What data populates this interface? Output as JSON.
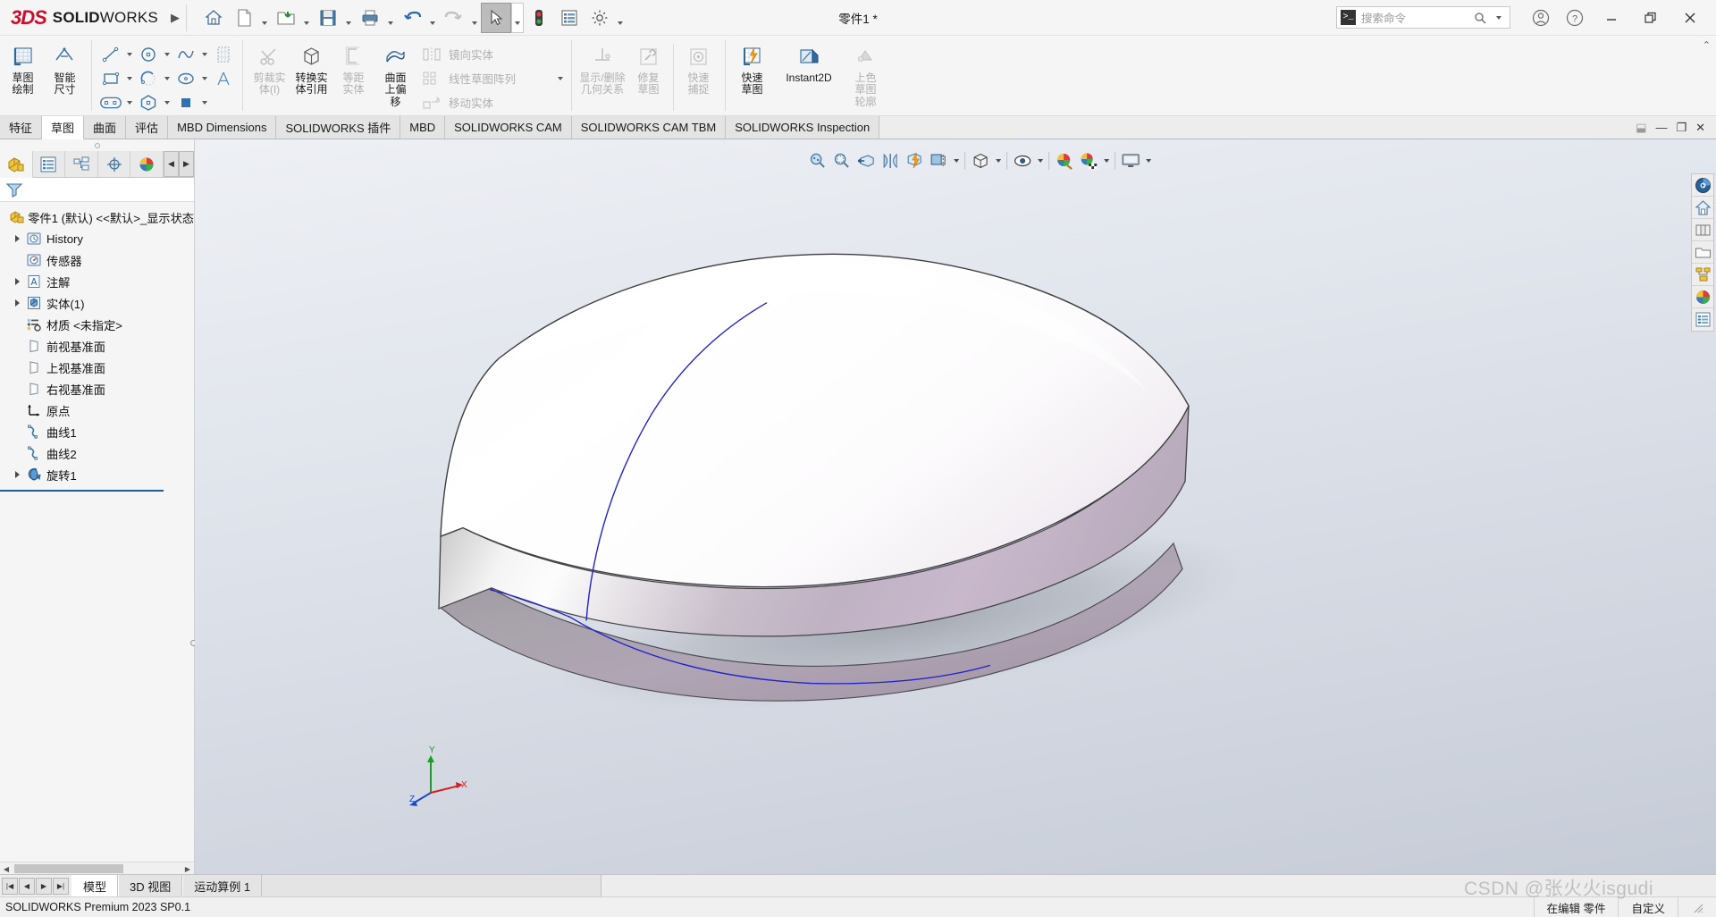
{
  "app": {
    "brand_ds": "3DS",
    "brand_solid": "SOLID",
    "brand_works": "WORKS",
    "document_title": "零件1 *",
    "version_status": "SOLIDWORKS Premium 2023 SP0.1"
  },
  "titlebar": {
    "icons": [
      {
        "name": "home-icon",
        "label": "主页"
      },
      {
        "name": "new-document-icon",
        "label": "新建"
      },
      {
        "name": "open-folder-icon",
        "label": "打开"
      },
      {
        "name": "save-icon",
        "label": "保存"
      },
      {
        "name": "print-icon",
        "label": "打印"
      },
      {
        "name": "undo-icon",
        "label": "撤销"
      },
      {
        "name": "redo-icon",
        "label": "重做"
      },
      {
        "name": "select-cursor-icon",
        "label": "选择"
      },
      {
        "name": "rebuild-traffic-icon",
        "label": "重建模型"
      },
      {
        "name": "options-list-icon",
        "label": "文件属性"
      },
      {
        "name": "gear-settings-icon",
        "label": "选项"
      }
    ],
    "search": {
      "placeholder": "搜索命令",
      "icon": "command-search-icon"
    },
    "account_icon": "account-circle-icon",
    "help_icon": "question-help-icon",
    "minimize_label": "最小化",
    "restore_label": "向下还原",
    "close_label": "关闭"
  },
  "ribbon": {
    "groups": [
      {
        "name": "sketch-group",
        "buttons": [
          {
            "name": "sketch-draw-button",
            "label": "草图\n绘制",
            "icon": "sketch-grid-icon",
            "disabled": false
          },
          {
            "name": "smart-dimension-button",
            "label": "智能\n尺寸",
            "icon": "smart-dimension-icon",
            "disabled": false
          }
        ]
      },
      {
        "name": "entities-group",
        "rows": [
          [
            {
              "name": "line-tool",
              "icon": "line-icon",
              "caret": true
            },
            {
              "name": "circle-tool",
              "icon": "circle-icon",
              "caret": true
            },
            {
              "name": "spline-tool",
              "icon": "spline-icon",
              "caret": true
            },
            {
              "name": "3dsketch-plane-tool",
              "icon": "sketch-plane-icon",
              "caret": false
            }
          ],
          [
            {
              "name": "rectangle-tool",
              "icon": "rectangle-icon",
              "caret": true
            },
            {
              "name": "arc-tool",
              "icon": "arc-icon",
              "caret": true
            },
            {
              "name": "ellipse-tool",
              "icon": "ellipse-icon",
              "caret": true
            },
            {
              "name": "text-tool",
              "icon": "text-a-icon",
              "caret": false
            }
          ],
          [
            {
              "name": "slot-tool",
              "icon": "slot-icon",
              "caret": true
            },
            {
              "name": "polygon-tool",
              "icon": "polygon-icon",
              "caret": false
            },
            {
              "name": "point-tool",
              "icon": "point-square-icon",
              "caret": true
            }
          ]
        ]
      },
      {
        "name": "modify-group",
        "buttons": [
          {
            "name": "trim-entities-button",
            "label": "剪裁实\n体(I)",
            "icon": "trim-scissors-icon",
            "disabled": true
          },
          {
            "name": "convert-entities-button",
            "label": "转换实\n体引用",
            "icon": "convert-cube-icon",
            "disabled": false
          },
          {
            "name": "offset-entities-button",
            "label": "等距\n实体",
            "icon": "offset-icon",
            "disabled": true
          },
          {
            "name": "offset-on-surface-button",
            "label": "曲面\n上偏\n移",
            "icon": "surface-offset-icon",
            "disabled": false
          }
        ],
        "side_items": [
          {
            "name": "mirror-entities-item",
            "label": "镜向实体",
            "icon": "mirror-icon",
            "disabled": true
          },
          {
            "name": "linear-sketch-pattern-item",
            "label": "线性草图阵列",
            "icon": "linear-pattern-icon",
            "disabled": true,
            "caret": true
          },
          {
            "name": "move-entities-item",
            "label": "移动实体",
            "icon": "move-entities-icon",
            "disabled": true,
            "caret": true
          }
        ]
      },
      {
        "name": "relations-group",
        "buttons": [
          {
            "name": "display-delete-relations-button",
            "label": "显示/删除\n几何关系",
            "icon": "relations-icon",
            "disabled": true
          },
          {
            "name": "repair-sketch-button",
            "label": "修复\n草图",
            "icon": "repair-wrench-icon",
            "disabled": true
          },
          {
            "name": "quick-snaps-button",
            "label": "快速\n捕捉",
            "icon": "quick-snap-icon",
            "disabled": true
          }
        ]
      },
      {
        "name": "tools-group",
        "buttons": [
          {
            "name": "rapid-sketch-button",
            "label": "快速\n草图",
            "icon": "rapid-sketch-icon",
            "disabled": false
          },
          {
            "name": "instant2d-button",
            "label": "Instant2D",
            "icon": "instant2d-icon",
            "disabled": false
          },
          {
            "name": "shaded-sketch-contours-button",
            "label": "上色\n草图\n轮廓",
            "icon": "shaded-contour-icon",
            "disabled": true
          }
        ]
      }
    ],
    "collapse_label": "︿"
  },
  "command_tabs": {
    "items": [
      {
        "name": "tab-features",
        "label": "特征",
        "active": false
      },
      {
        "name": "tab-sketch",
        "label": "草图",
        "active": true
      },
      {
        "name": "tab-surfaces",
        "label": "曲面",
        "active": false
      },
      {
        "name": "tab-evaluate",
        "label": "评估",
        "active": false
      },
      {
        "name": "tab-mbd-dimensions",
        "label": "MBD Dimensions",
        "active": false
      },
      {
        "name": "tab-solidworks-addins",
        "label": "SOLIDWORKS 插件",
        "active": false
      },
      {
        "name": "tab-mbd",
        "label": "MBD",
        "active": false
      },
      {
        "name": "tab-solidworks-cam",
        "label": "SOLIDWORKS CAM",
        "active": false
      },
      {
        "name": "tab-solidworks-cam-tbm",
        "label": "SOLIDWORKS CAM TBM",
        "active": false
      },
      {
        "name": "tab-solidworks-inspection",
        "label": "SOLIDWORKS Inspection",
        "active": false
      }
    ],
    "window_buttons": [
      {
        "name": "restore-doc-window",
        "label": "⬓"
      },
      {
        "name": "minimize-doc-window",
        "label": "—"
      },
      {
        "name": "maximize-doc-window",
        "label": "❐"
      },
      {
        "name": "close-doc-window",
        "label": "✕"
      }
    ]
  },
  "feature_manager": {
    "tabs": [
      {
        "name": "feature-manager-tab",
        "icon": "feature-tree-icon",
        "active": true
      },
      {
        "name": "property-manager-tab",
        "icon": "property-list-icon",
        "active": false
      },
      {
        "name": "configuration-manager-tab",
        "icon": "configuration-icon",
        "active": false
      },
      {
        "name": "dimxpert-manager-tab",
        "icon": "dimxpert-target-icon",
        "active": false
      },
      {
        "name": "display-manager-tab",
        "icon": "display-sphere-icon",
        "active": false
      },
      {
        "name": "extra-panel-tab",
        "icon": "extra-panel-icon",
        "active": false
      }
    ],
    "scroll_left_label": "◀",
    "scroll_right_label": "▶",
    "filter_placeholder": "",
    "filter_icon": "funnel-filter-icon",
    "tree": [
      {
        "name": "tree-root-part",
        "label": "零件1 (默认) <<默认>_显示状态",
        "icon": "part-icon",
        "expandable": false,
        "indent": 0
      },
      {
        "name": "tree-item-history",
        "label": "History",
        "icon": "history-clock-icon",
        "expandable": true,
        "indent": 1
      },
      {
        "name": "tree-item-sensors",
        "label": "传感器",
        "icon": "sensor-icon",
        "expandable": false,
        "indent": 1
      },
      {
        "name": "tree-item-annotations",
        "label": "注解",
        "icon": "annotations-a-icon",
        "expandable": true,
        "indent": 1
      },
      {
        "name": "tree-item-solid-bodies",
        "label": "实体(1)",
        "icon": "solid-bodies-icon",
        "expandable": true,
        "indent": 1
      },
      {
        "name": "tree-item-material",
        "label": "材质 <未指定>",
        "icon": "material-icon",
        "expandable": false,
        "indent": 1
      },
      {
        "name": "tree-item-front-plane",
        "label": "前视基准面",
        "icon": "plane-icon",
        "expandable": false,
        "indent": 1
      },
      {
        "name": "tree-item-top-plane",
        "label": "上视基准面",
        "icon": "plane-icon",
        "expandable": false,
        "indent": 1
      },
      {
        "name": "tree-item-right-plane",
        "label": "右视基准面",
        "icon": "plane-icon",
        "expandable": false,
        "indent": 1
      },
      {
        "name": "tree-item-origin",
        "label": "原点",
        "icon": "origin-axes-icon",
        "expandable": false,
        "indent": 1
      },
      {
        "name": "tree-item-curve1",
        "label": "曲线1",
        "icon": "curve-icon",
        "expandable": false,
        "indent": 1
      },
      {
        "name": "tree-item-curve2",
        "label": "曲线2",
        "icon": "curve-icon",
        "expandable": false,
        "indent": 1
      },
      {
        "name": "tree-item-revolve1",
        "label": "旋转1",
        "icon": "revolve-icon",
        "expandable": true,
        "indent": 1
      }
    ]
  },
  "view_toolbar": {
    "items": [
      {
        "name": "zoom-to-fit-button",
        "icon": "zoom-fit-icon",
        "caret": false
      },
      {
        "name": "zoom-to-area-button",
        "icon": "zoom-area-icon",
        "caret": false
      },
      {
        "name": "section-view-button",
        "icon": "section-view-icon",
        "caret": false
      },
      {
        "name": "view-orientation-button",
        "icon": "view-orientation-icon",
        "caret": false
      },
      {
        "name": "quick-section-button",
        "icon": "quick-lightning-icon",
        "caret": false
      },
      {
        "name": "view-setting-button",
        "icon": "view-cube-setting-icon",
        "caret": true
      },
      {
        "name": "display-style-button",
        "icon": "display-style-cube-icon",
        "caret": true
      },
      {
        "name": "hide-show-items-button",
        "icon": "hide-show-eye-icon",
        "caret": true
      },
      {
        "name": "edit-appearance-button",
        "icon": "appearance-sphere-icon",
        "caret": false
      },
      {
        "name": "apply-scene-button",
        "icon": "scene-sphere-icon",
        "caret": true
      },
      {
        "name": "view-settings-button",
        "icon": "monitor-icon",
        "caret": true
      }
    ]
  },
  "right_toolbar": {
    "items": [
      {
        "name": "view-selector-button",
        "icon": "view-selector-sphere-icon"
      },
      {
        "name": "home-view-button",
        "icon": "home-house-icon"
      },
      {
        "name": "assembly-book-button",
        "icon": "book-stack-icon"
      },
      {
        "name": "open-folder-button",
        "icon": "folder-open-icon"
      },
      {
        "name": "hierarchy-button",
        "icon": "hierarchy-icon"
      },
      {
        "name": "appearance-button",
        "icon": "appearance-ball-icon"
      },
      {
        "name": "properties-button",
        "icon": "properties-list-icon"
      }
    ]
  },
  "triad": {
    "x_label": "X",
    "y_label": "Y",
    "z_label": "Z"
  },
  "document_tabs": {
    "nav_first": "|◀",
    "nav_prev": "◀",
    "nav_next": "▶",
    "nav_last": "▶|",
    "items": [
      {
        "name": "doc-tab-model",
        "label": "模型",
        "active": true
      },
      {
        "name": "doc-tab-3dviews",
        "label": "3D 视图",
        "active": false
      },
      {
        "name": "doc-tab-motion-study",
        "label": "运动算例 1",
        "active": false
      }
    ]
  },
  "status_bar": {
    "version": "SOLIDWORKS Premium 2023 SP0.1",
    "editing": "在编辑 零件",
    "custom": "自定义",
    "watermark": "CSDN @张火火isgudi"
  },
  "model": {
    "description": "旋转曲面实体 — 白色上表面与淡紫色侧面，带有两条蓝色草图曲线",
    "top_color": "#ffffff",
    "side_color": "#c4b2c6",
    "sketch_curve_color": "#2222cc",
    "shadow_color": "#9a9fa8"
  }
}
